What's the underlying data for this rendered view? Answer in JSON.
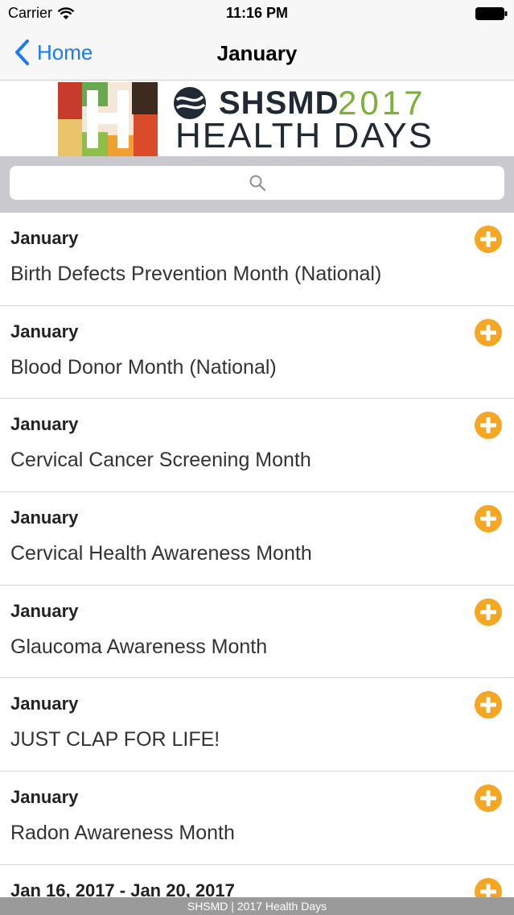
{
  "status_bar": {
    "carrier": "Carrier",
    "time": "11:16 PM"
  },
  "nav": {
    "back_label": "Home",
    "title": "January"
  },
  "banner": {
    "org": "SHSMD",
    "year": "2017",
    "subtitle": "HEALTH DAYS"
  },
  "search": {
    "placeholder": ""
  },
  "events": [
    {
      "date": "January",
      "title": "Birth Defects Prevention Month (National)"
    },
    {
      "date": "January",
      "title": "Blood Donor Month (National)"
    },
    {
      "date": "January",
      "title": "Cervical Cancer Screening Month"
    },
    {
      "date": "January",
      "title": "Cervical Health Awareness Month"
    },
    {
      "date": "January",
      "title": "Glaucoma Awareness Month"
    },
    {
      "date": "January",
      "title": "JUST CLAP FOR LIFE!"
    },
    {
      "date": "January",
      "title": "Radon Awareness Month"
    },
    {
      "date": "Jan 16, 2017 - Jan 20, 2017",
      "title": ""
    }
  ],
  "footer": {
    "text": "SHSMD | 2017 Health Days"
  },
  "colors": {
    "accent": "#1a7cf5",
    "add_icon": "#f5a623",
    "banner_year": "#79b13a"
  },
  "icons": [
    "wifi-icon",
    "battery-icon",
    "back-chevron-icon",
    "search-icon",
    "add-circle-icon"
  ]
}
